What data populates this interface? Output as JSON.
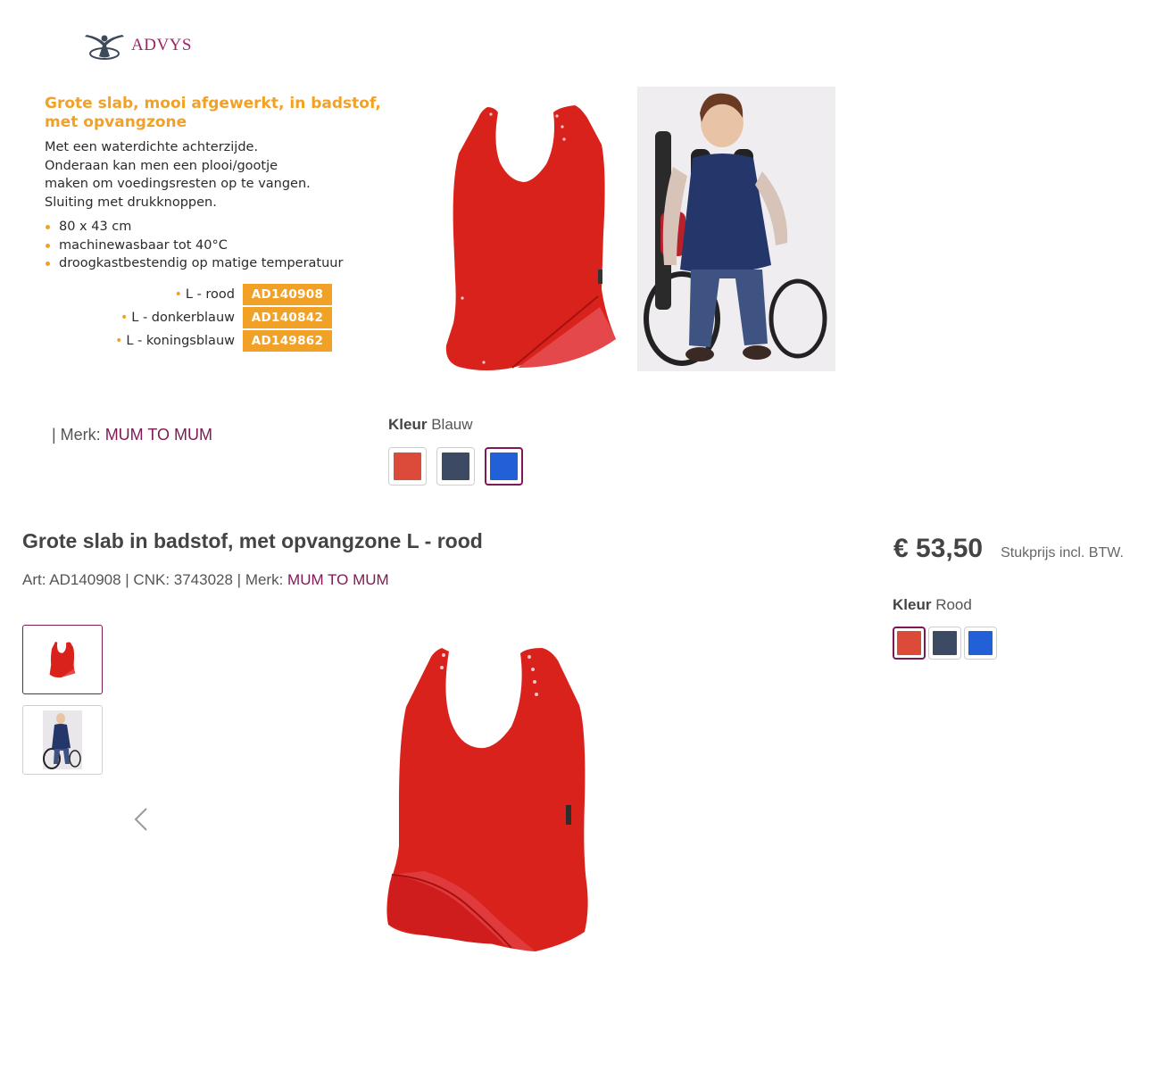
{
  "catalog": {
    "logo_text": "ADVYS",
    "title": "Grote slab, mooi afgewerkt, in badstof, met opvangzone",
    "description_lines": [
      "Met een waterdichte achterzijde.",
      "Onderaan kan men een plooi/gootje",
      "maken om voedingsresten op te vangen.",
      "Sluiting met drukknoppen."
    ],
    "bullets": [
      "80 x 43 cm",
      "machinewasbaar tot 40°C",
      "droogkastbestendig op matige temperatuur"
    ],
    "variants": [
      {
        "label": "L - rood",
        "code": "AD140908"
      },
      {
        "label": "L - donkerblauw",
        "code": "AD140842"
      },
      {
        "label": "L - koningsblauw",
        "code": "AD149862"
      }
    ]
  },
  "brand_line": {
    "prefix": "| Merk: ",
    "brand": "MUM TO MUM"
  },
  "color_selector_top": {
    "label": "Kleur",
    "selected": "Blauw",
    "selected_index": 2
  },
  "product": {
    "title": "Grote slab in badstof, met opvangzone L - rood",
    "meta_prefix": "Art: AD140908 | CNK: 3743028 | Merk: ",
    "brand": "MUM TO MUM",
    "price": "€ 53,50",
    "price_note": "Stukprijs incl. BTW.",
    "color_label": "Kleur",
    "color_selected": "Rood",
    "color_selected_index": 0
  },
  "swatch_colors": [
    {
      "name": "rood",
      "hex": "#dc4a3a"
    },
    {
      "name": "donkerblauw",
      "hex": "#3d4a64"
    },
    {
      "name": "koningsblauw",
      "hex": "#2160d6"
    }
  ],
  "accent_color": "#f2a127",
  "brand_color": "#7d1a54",
  "icons": {
    "gallery_prev": "chevron-left-icon"
  }
}
